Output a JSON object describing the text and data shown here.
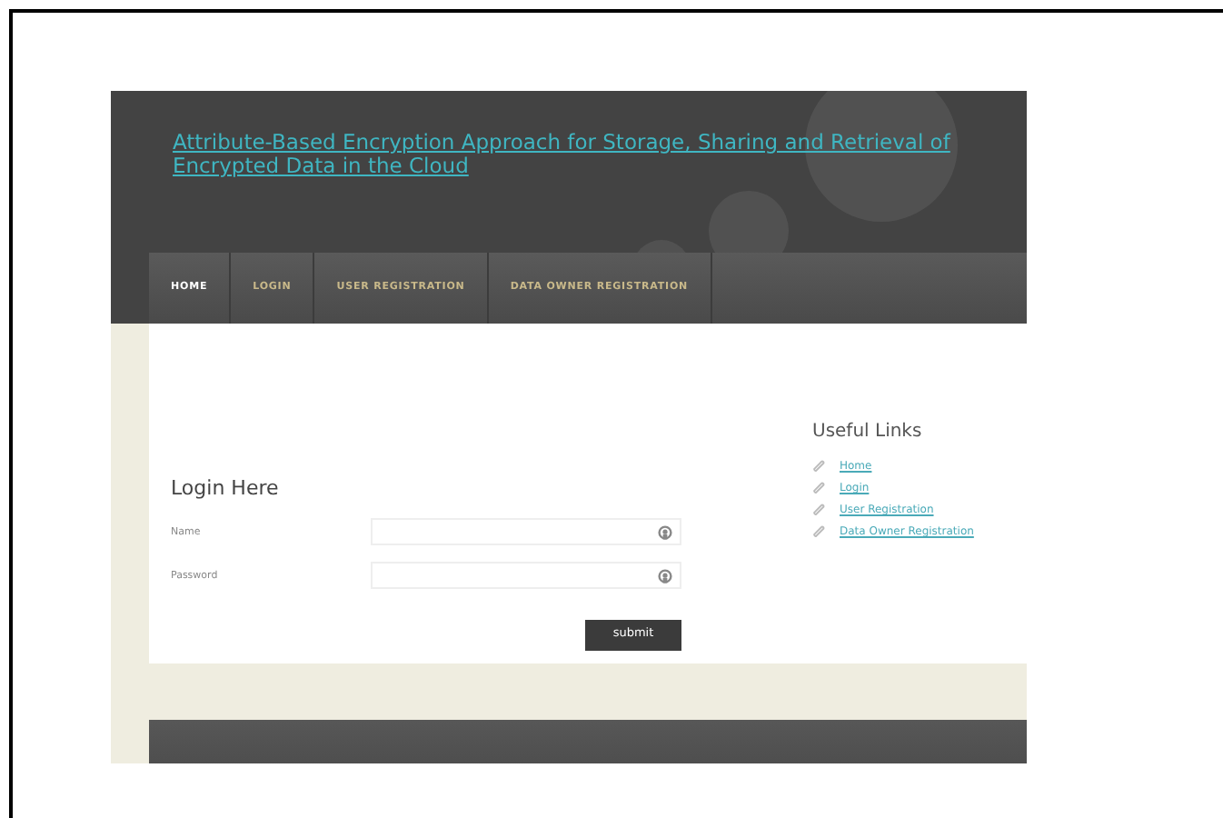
{
  "site_title": "Attribute-Based Encryption Approach for Storage, Sharing and Retrieval of Encrypted Data in the Cloud",
  "nav": [
    {
      "label": "HOME",
      "selected": true
    },
    {
      "label": "LOGIN",
      "selected": false
    },
    {
      "label": "USER REGISTRATION",
      "selected": false
    },
    {
      "label": "DATA OWNER REGISTRATION",
      "selected": false
    }
  ],
  "login": {
    "heading": "Login Here",
    "fields": [
      {
        "label": "Name"
      },
      {
        "label": "Password"
      }
    ],
    "submit": "submit"
  },
  "useful_links": {
    "heading": "Useful Links",
    "links": [
      "Home",
      "Login",
      "User Registration",
      "Data Owner Registration"
    ]
  }
}
